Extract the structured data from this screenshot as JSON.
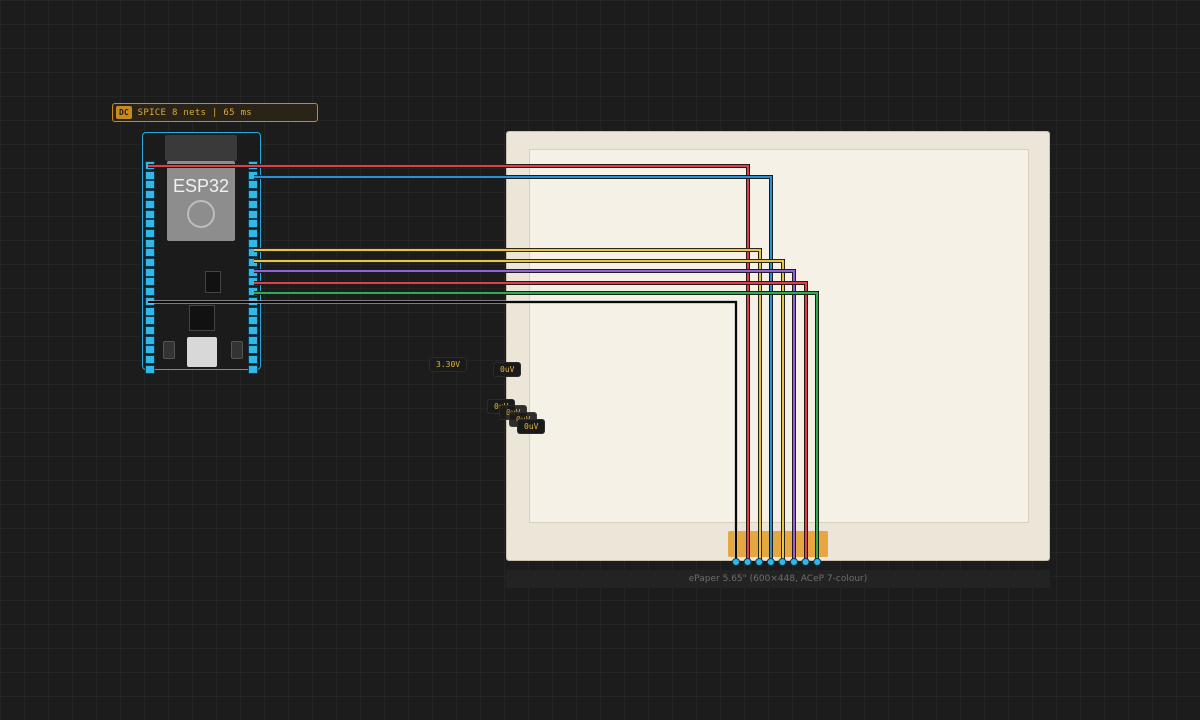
{
  "sim_badge": {
    "mode": "DC",
    "status": "SPICE 8 nets | 65 ms"
  },
  "esp32": {
    "label": "ESP32",
    "left_pins": 22,
    "right_pins": 22
  },
  "epaper": {
    "caption": "ePaper 5.65\" (600×448, ACeP 7-colour)",
    "pin_count": 8
  },
  "probes": [
    {
      "id": "probe-3v3",
      "value": "3.30V"
    },
    {
      "id": "probe-a",
      "value": "0uV"
    },
    {
      "id": "probe-b",
      "value": "0uV"
    },
    {
      "id": "probe-c",
      "value": "0uV"
    },
    {
      "id": "probe-d",
      "value": "0uV"
    },
    {
      "id": "probe-e",
      "value": "0uV"
    }
  ],
  "wire_colors": {
    "red": "#d8434a",
    "blue": "#2e8fd0",
    "yellow": "#e7c44a",
    "purple": "#9163d6",
    "green": "#36a852",
    "black": "#0a0a0a"
  }
}
